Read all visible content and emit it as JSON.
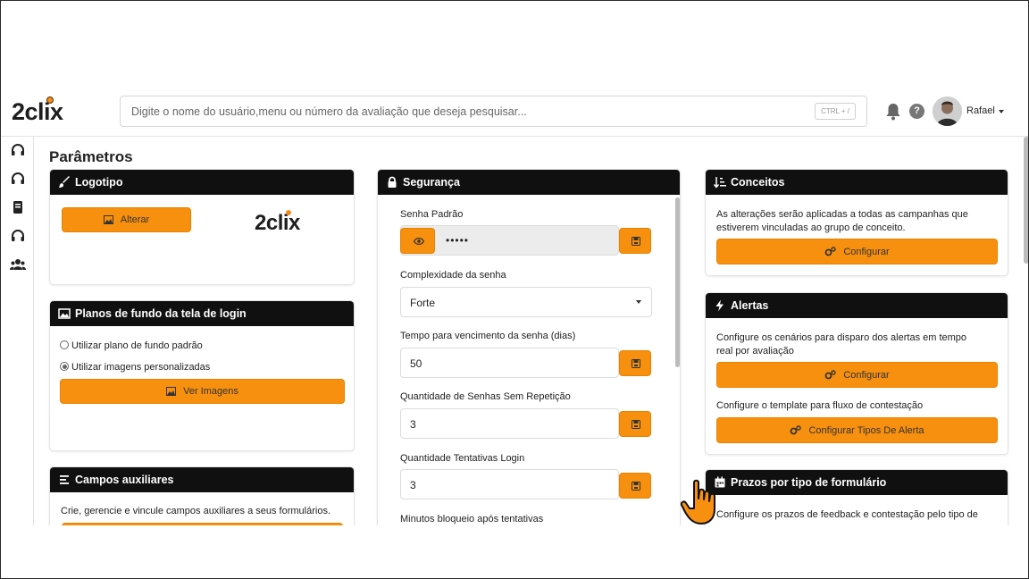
{
  "header": {
    "logo": "2clix",
    "search_placeholder": "Digite o nome do usuário,menu ou número da avaliação que deseja pesquisar...",
    "shortcut": "CTRL + /",
    "help": "?",
    "user_name": "Rafael"
  },
  "sidebar": {
    "icons": [
      "headset-icon",
      "headset-icon",
      "book-icon",
      "headset-icon",
      "users-icon"
    ]
  },
  "page": {
    "title": "Parâmetros"
  },
  "logotipo": {
    "title": "Logotipo",
    "button": "Alterar",
    "logo_text": "2clix"
  },
  "planos": {
    "title": "Planos de fundo da tela de login",
    "option_default": "Utilizar plano de fundo padrão",
    "option_custom": "Utilizar imagens personalizadas",
    "selected": "custom",
    "button": "Ver Imagens"
  },
  "campos": {
    "title": "Campos auxiliares",
    "description": "Crie, gerencie e vincule campos auxiliares a seus formulários."
  },
  "seguranca": {
    "title": "Segurança",
    "senha_label": "Senha Padrão",
    "senha_value": "•••••",
    "complexidade_label": "Complexidade da senha",
    "complexidade_value": "Forte",
    "vencimento_label": "Tempo para vencimento da senha (dias)",
    "vencimento_value": "50",
    "repeticao_label": "Quantidade de Senhas Sem Repetição",
    "repeticao_value": "3",
    "tentativas_label": "Quantidade Tentativas Login",
    "tentativas_value": "3",
    "bloqueio_label": "Minutos bloqueio após tentativas"
  },
  "conceitos": {
    "title": "Conceitos",
    "description": "As alterações serão aplicadas a todas as campanhas que estiverem vinculadas ao grupo de conceito.",
    "button": "Configurar"
  },
  "alertas": {
    "title": "Alertas",
    "description": "Configure os cenários para disparo dos alertas em tempo real por avaliação",
    "button": "Configurar",
    "description2": "Configure o template para fluxo de contestação",
    "button2": "Configurar Tipos De Alerta"
  },
  "prazos": {
    "title": "Prazos por tipo de formulário",
    "description": "Configure os prazos de feedback e contestação pelo tipo de"
  },
  "colors": {
    "accent": "#f7900f",
    "header": "#101010"
  }
}
